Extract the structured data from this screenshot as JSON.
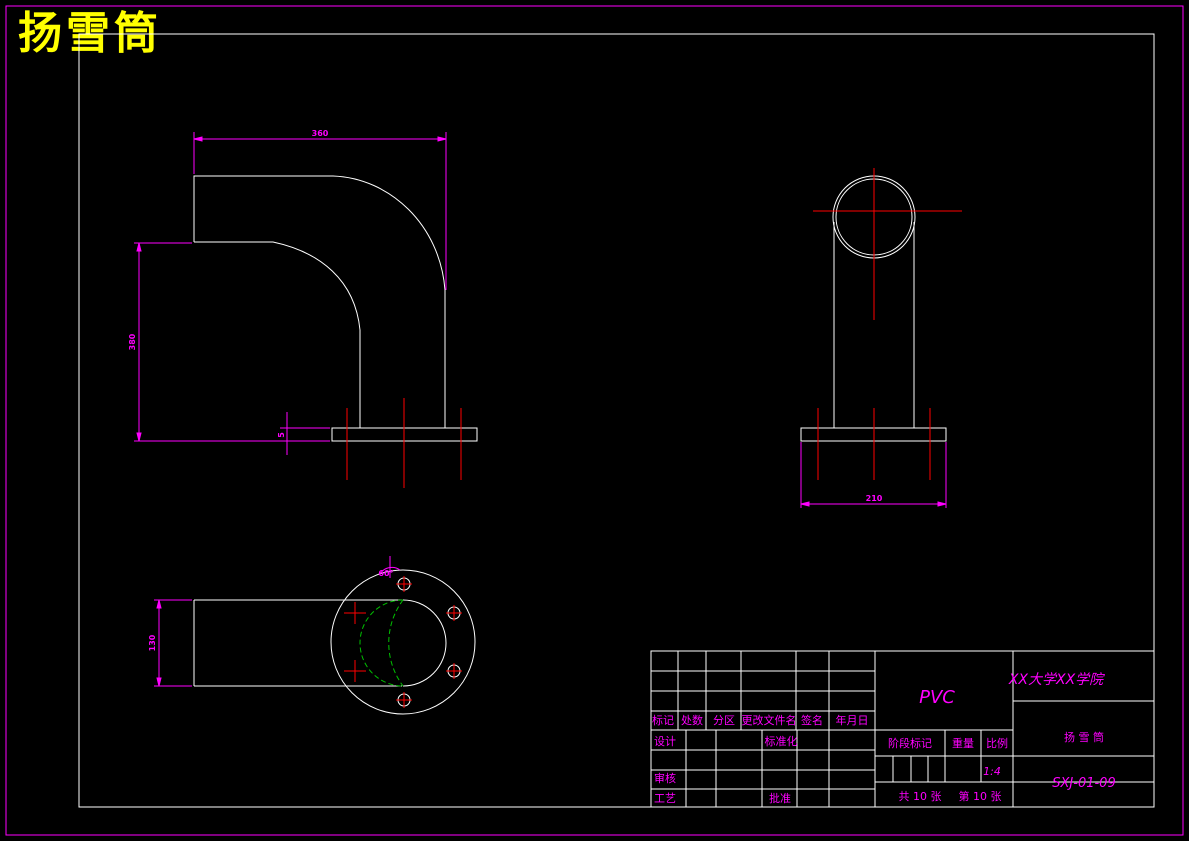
{
  "drawing": {
    "title": "扬雪筒",
    "colors": {
      "background": "#000000",
      "outline": "#ffffff",
      "border": "#ff00ff",
      "centerline": "#ff0000",
      "dimension": "#ff00ff",
      "hidden_circle": "#00c000",
      "title_text": "#ffff00"
    },
    "dimensions": {
      "front_width": "360",
      "front_height": "380",
      "flange_thickness": "5",
      "side_flange_width": "210",
      "top_width": "130",
      "angle": "60°"
    }
  },
  "title_block": {
    "material": "PVC",
    "school": "XX大学XX学院",
    "part_name": "扬 雪 筒",
    "drawing_no": "SXJ-01-09",
    "scale": "1:4",
    "headers": [
      "标记",
      "处数",
      "分区",
      "更改文件名",
      "签名",
      "年月日"
    ],
    "row_labels": {
      "design": "设计",
      "standard": "标准化",
      "review": "审核",
      "process": "工艺",
      "approve": "批准",
      "stage": "阶段标记",
      "weight": "重量",
      "ratio": "比例",
      "sheets_total": "共 10 张",
      "sheet_no": "第 10 张"
    }
  }
}
